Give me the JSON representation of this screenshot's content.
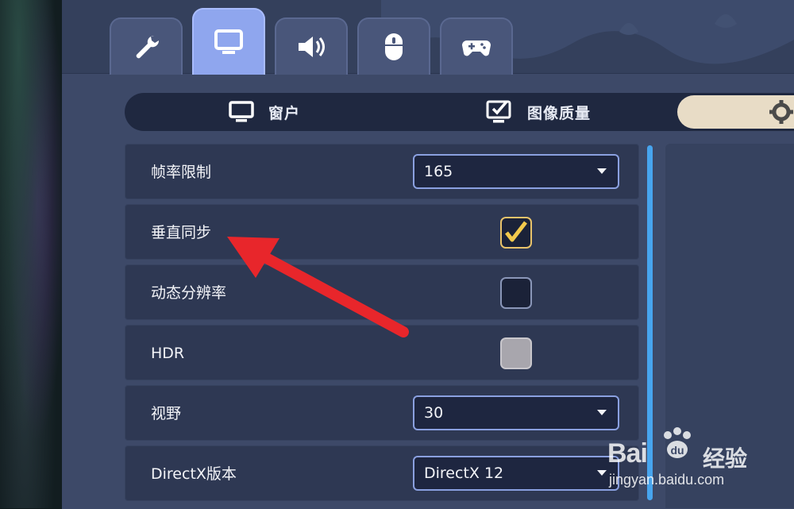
{
  "category_tabs": [
    {
      "icon": "wrench-icon"
    },
    {
      "icon": "monitor-icon",
      "active": true
    },
    {
      "icon": "speaker-icon"
    },
    {
      "icon": "mouse-icon"
    },
    {
      "icon": "gamepad-icon"
    }
  ],
  "sub_tabs": [
    {
      "label": "窗户",
      "icon": "monitor-icon"
    },
    {
      "label": "图像质量",
      "icon": "monitor-check-icon"
    },
    {
      "label": "",
      "icon": "gear-icon",
      "active": true
    }
  ],
  "settings": {
    "frame_limit": {
      "label": "帧率限制",
      "value": "165"
    },
    "vsync": {
      "label": "垂直同步",
      "checked": true
    },
    "dynamic_resolution": {
      "label": "动态分辨率",
      "checked": false
    },
    "hdr": {
      "label": "HDR",
      "checked": false,
      "disabled": true
    },
    "fov": {
      "label": "视野",
      "value": "30"
    },
    "directx": {
      "label": "DirectX版本",
      "value": "DirectX 12"
    }
  },
  "watermark": {
    "brand": "Bai",
    "brand_cn": "经验",
    "url": "jingyan.baidu.com"
  },
  "colors": {
    "accent": "#8fa6ee",
    "check": "#e9c36a",
    "arrow": "#e8262b",
    "scrollbar": "#47a4ee"
  }
}
